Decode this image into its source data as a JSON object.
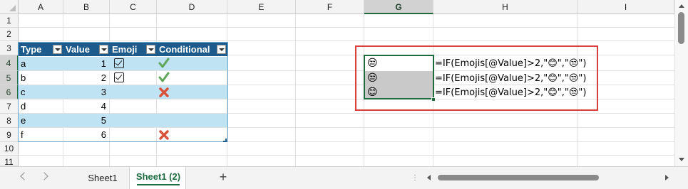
{
  "sheet": {
    "columns": [
      "A",
      "B",
      "C",
      "D",
      "E",
      "F",
      "G",
      "H",
      "I"
    ],
    "rows": [
      "1",
      "2",
      "3",
      "4",
      "5",
      "6",
      "7",
      "8",
      "9",
      "10",
      "11"
    ],
    "selected_column": "G",
    "selected_rows": [
      "4",
      "5",
      "6"
    ]
  },
  "table": {
    "headers": [
      "Type",
      "Value",
      "Emoji",
      "Conditional"
    ],
    "rows": [
      {
        "type": "a",
        "value": "1",
        "checkbox": true,
        "mark": "check"
      },
      {
        "type": "b",
        "value": "2",
        "checkbox": true,
        "mark": "check"
      },
      {
        "type": "c",
        "value": "3",
        "checkbox": false,
        "mark": "cross"
      },
      {
        "type": "d",
        "value": "4",
        "checkbox": false,
        "mark": ""
      },
      {
        "type": "e",
        "value": "5",
        "checkbox": false,
        "mark": ""
      },
      {
        "type": "f",
        "value": "6",
        "checkbox": false,
        "mark": "cross"
      }
    ]
  },
  "emoji_cells": [
    "😒",
    "😒",
    "😊"
  ],
  "formulas": [
    "=IF(Emojis[@Value]>2,\"😊\",\"😒\")",
    "=IF(Emojis[@Value]>2,\"😊\",\"😒\")",
    "=IF(Emojis[@Value]>2,\"😊\",\"😒\")"
  ],
  "tabs": {
    "sheets": [
      "Sheet1",
      "Sheet1 (2)"
    ],
    "active": "Sheet1 (2)",
    "add_label": "+"
  },
  "colors": {
    "header_blue": "#1c5b8c",
    "band_blue": "#bfe3f3",
    "highlight_red": "#d9403c",
    "selection_green": "#1e6b3f",
    "check_green": "#5fa55a",
    "cross_red": "#d9533c"
  }
}
